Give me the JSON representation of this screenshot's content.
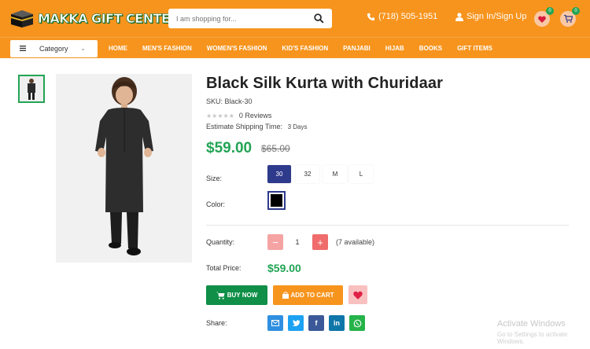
{
  "header": {
    "logo_text": "MAKKA GIFT CENTER",
    "search_placeholder": "I am shopping for...",
    "phone": "(718) 505-1951",
    "signin": "Sign In/Sign Up",
    "wishlist_count": "0",
    "cart_count": "0"
  },
  "nav": {
    "category_label": "Category",
    "links": [
      "HOME",
      "MEN'S FASHION",
      "WOMEN'S FASHION",
      "KID'S FASHION",
      "PANJABI",
      "HIJAB",
      "BOOKS",
      "GIFT ITEMS"
    ]
  },
  "product": {
    "title": "Black Silk Kurta with Churidaar",
    "sku": "SKU: Black-30",
    "reviews": "0 Reviews",
    "rating_stars": 0,
    "shipping_label": "Estimate Shipping Time:",
    "shipping_days": "3 Days",
    "price": "$59.00",
    "old_price": "$65.00",
    "size_label": "Size:",
    "sizes": [
      "30",
      "32",
      "M",
      "L"
    ],
    "selected_size": "30",
    "color_label": "Color:",
    "selected_color": "#000000",
    "quantity_label": "Quantity:",
    "quantity": "1",
    "available": "(7 available)",
    "total_label": "Total Price:",
    "total_price": "$59.00",
    "buy_now": "BUY NOW",
    "add_to_cart": "ADD TO CART",
    "share_label": "Share:"
  },
  "watermark": {
    "line1": "Activate Windows",
    "line2": "Go to Settings to activate Windows."
  },
  "colors": {
    "brand_orange": "#f7941d",
    "green": "#23a455",
    "navy": "#2e3a8c"
  }
}
